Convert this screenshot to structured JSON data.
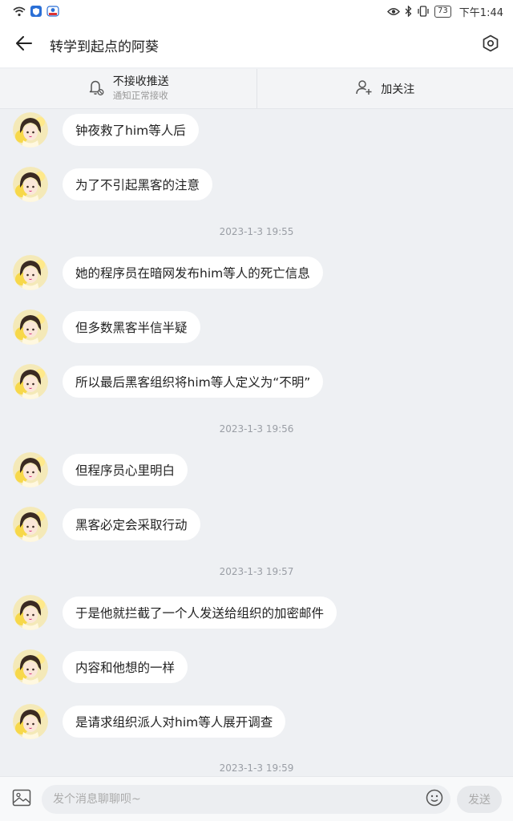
{
  "status_bar": {
    "battery": "73",
    "time": "下午1:44",
    "left_icons": [
      "wifi-icon",
      "shield-app-icon",
      "notification-app-icon"
    ],
    "right_icons": [
      "eye-icon",
      "bluetooth-icon",
      "vibrate-icon",
      "battery-icon"
    ]
  },
  "header": {
    "title": "转学到起点的阿葵",
    "back_icon": "back-arrow-icon",
    "settings_icon": "settings-hex-icon"
  },
  "actions": {
    "mute": {
      "label": "不接收推送",
      "sub": "通知正常接收",
      "icon": "bell-off-icon"
    },
    "follow": {
      "label": "加关注",
      "icon": "add-user-icon"
    }
  },
  "messages": [
    {
      "type": "msg",
      "text": "钟夜救了him等人后"
    },
    {
      "type": "msg",
      "text": "为了不引起黑客的注意"
    },
    {
      "type": "time",
      "text": "2023-1-3 19:55"
    },
    {
      "type": "msg",
      "text": "她的程序员在暗网发布him等人的死亡信息"
    },
    {
      "type": "msg",
      "text": "但多数黑客半信半疑"
    },
    {
      "type": "msg",
      "text": "所以最后黑客组织将him等人定义为“不明”"
    },
    {
      "type": "time",
      "text": "2023-1-3 19:56"
    },
    {
      "type": "msg",
      "text": "但程序员心里明白"
    },
    {
      "type": "msg",
      "text": "黑客必定会采取行动"
    },
    {
      "type": "time",
      "text": "2023-1-3 19:57"
    },
    {
      "type": "msg",
      "text": "于是他就拦截了一个人发送给组织的加密邮件"
    },
    {
      "type": "msg",
      "text": "内容和他想的一样"
    },
    {
      "type": "msg",
      "text": "是请求组织派人对him等人展开调查"
    },
    {
      "type": "time",
      "text": "2023-1-3 19:59"
    }
  ],
  "input_bar": {
    "placeholder": "发个消息聊聊呗~",
    "send_label": "发送",
    "image_icon": "image-icon",
    "emoji_icon": "emoji-icon"
  },
  "colors": {
    "background": "#eef0f3",
    "bubble": "#ffffff",
    "timestamp": "#9a9ea5"
  }
}
